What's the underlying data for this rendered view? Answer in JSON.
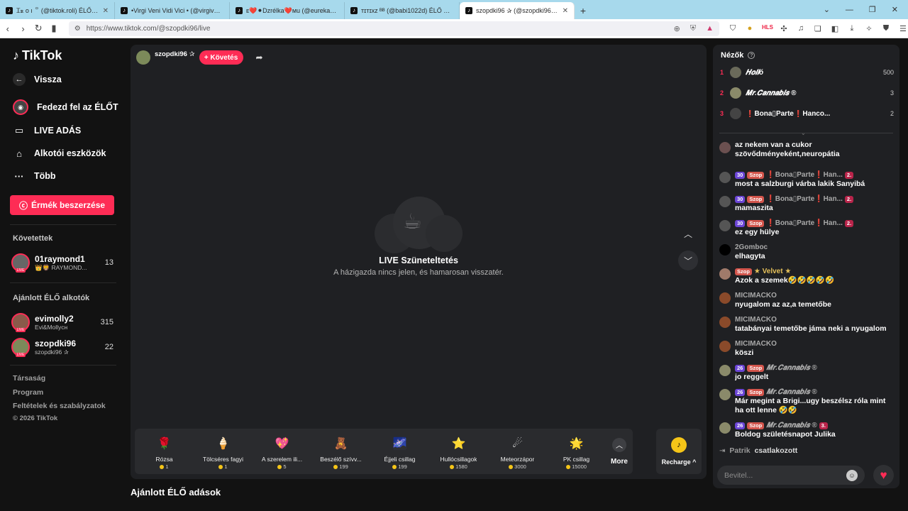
{
  "browser": {
    "tabs": [
      {
        "title": "Ꮖꭱ ᴏ ı ꒪ (@tiktok.roli) ÉLŐ adá",
        "active": false
      },
      {
        "title": "•Virgi Veni Vidi Vici • (@virgivenividi",
        "active": false
      },
      {
        "title": "ᴇ❤️⚫Dᴢrélka❤️ᴍu (@eurekaeurek",
        "active": false
      },
      {
        "title": "ᴛɪᴛɪxᴢ ᴮᴮ (@babi1022d) ÉLŐ adásban",
        "active": false
      },
      {
        "title": "szopdki96 ✰ (@szopdki96) ÉLŐ a",
        "active": true
      }
    ],
    "new_tab": "+",
    "url": "https://www.tiktok.com/@szopdki96/live"
  },
  "sidebar": {
    "logo": "TikTok",
    "back": "Vissza",
    "menu": [
      {
        "label": "Fedezd fel az ÉLŐT",
        "icon": "live-explore-icon"
      },
      {
        "label": "LIVE ADÁS",
        "icon": "video-camera-icon"
      },
      {
        "label": "Alkotói eszközök",
        "icon": "creator-tools-icon"
      },
      {
        "label": "Több",
        "icon": "more-dots-icon"
      }
    ],
    "coins_button": "Érmék beszerzése",
    "following_title": "Követettek",
    "following": [
      {
        "name": "01raymond1",
        "sub": "👑🦁 RAYMOND...",
        "count": "13"
      }
    ],
    "recommended_title": "Ajánlott ÉLŐ alkotók",
    "recommended": [
      {
        "name": "evimolly2",
        "sub": "Evi&Mollycн",
        "count": "315"
      },
      {
        "name": "szopdki96",
        "sub": "szopdki96 ✰",
        "count": "22"
      }
    ],
    "footer": [
      "Társaság",
      "Program",
      "Feltételek és szabályzatok",
      "© 2026 TikTok"
    ]
  },
  "stage": {
    "host_name": "szopdki96 ✰",
    "follow_label": "+ Követés",
    "pause_title": "LIVE Szüneteltetés",
    "pause_sub": "A házigazda nincs jelen, és hamarosan visszatér."
  },
  "gifts": [
    {
      "name": "Rózsa",
      "price": "1",
      "icon": "🌹"
    },
    {
      "name": "Tölcséres fagyi",
      "price": "1",
      "icon": "🍦"
    },
    {
      "name": "A szerelem ili...",
      "price": "5",
      "icon": "💖"
    },
    {
      "name": "Beszélő szívv...",
      "price": "199",
      "icon": "🧸"
    },
    {
      "name": "Éjjeli csillag",
      "price": "199",
      "icon": "🌌"
    },
    {
      "name": "Hullócsillagok",
      "price": "1580",
      "icon": "⭐"
    },
    {
      "name": "Meteorzápor",
      "price": "3000",
      "icon": "☄"
    },
    {
      "name": "PK csillag",
      "price": "15000",
      "icon": "🌟"
    }
  ],
  "more_label": "More",
  "recharge_label": "Recharge ^",
  "recommended_heading": "Ajánlott ÉLŐ adások",
  "panel": {
    "title": "Nézők",
    "viewers": [
      {
        "rank": "1",
        "name": "𝑯𝒐𝒍𝒍ó",
        "count": "500"
      },
      {
        "rank": "2",
        "name": "𝑴𝒓.𝑪𝒂𝒏𝒏𝒂𝒃𝒊𝒔 ®",
        "count": "3"
      },
      {
        "rank": "3",
        "name": "❗Bona▯Parte❗Hanco...",
        "count": "2"
      }
    ],
    "messages": [
      {
        "lvl": "",
        "sub": "",
        "user": "",
        "rank": "",
        "text": "az nekem van a cukor szövődményeként,neuropátia"
      },
      {
        "lvl": "30",
        "sub": "Szop",
        "user": "❗Bona▯Parte❗Han...",
        "rank": "2.",
        "text": "most a salzburgi várba lakik Sanyibá"
      },
      {
        "lvl": "30",
        "sub": "Szop",
        "user": "❗Bona▯Parte❗Han...",
        "rank": "2.",
        "text": "mamaszita"
      },
      {
        "lvl": "30",
        "sub": "Szop",
        "user": "❗Bona▯Parte❗Han...",
        "rank": "2.",
        "text": "ez egy hülye"
      },
      {
        "lvl": "",
        "sub": "",
        "user": "2Gomboc",
        "rank": "",
        "text": "elhagyta"
      },
      {
        "lvl": "",
        "sub": "Szop",
        "user": "★ Velvet ★",
        "rank": "",
        "text": "Azok a szemek🤣🤣🤣🤣🤣"
      },
      {
        "lvl": "",
        "sub": "",
        "user": "MICIMACKO",
        "rank": "",
        "text": "nyugalom az az,a temetőbe"
      },
      {
        "lvl": "",
        "sub": "",
        "user": "MICIMACKO",
        "rank": "",
        "text": "tatabányai temetőbe jáma neki a nyugalom"
      },
      {
        "lvl": "",
        "sub": "",
        "user": "MICIMACKO",
        "rank": "",
        "text": "köszi"
      },
      {
        "lvl": "26",
        "sub": "Szop",
        "user": "𝑴𝒓.𝑪𝒂𝒏𝒏𝒂𝒃𝒊𝒔 ®",
        "rank": "",
        "text": "jo reggelt"
      },
      {
        "lvl": "26",
        "sub": "Szop",
        "user": "𝑴𝒓.𝑪𝒂𝒏𝒏𝒂𝒃𝒊𝒔 ®",
        "rank": "",
        "text": "Már megint a Brigi...ugy beszélsz róla mint ha ott lenne 🤣🤣"
      },
      {
        "lvl": "26",
        "sub": "Szop",
        "user": "𝑴𝒓.𝑪𝒂𝒏𝒏𝒂𝒃𝒊𝒔 ®",
        "rank": "3.",
        "text": "Boldog születésnapot Julika"
      }
    ],
    "join_user": "Patrik",
    "join_text": "csatlakozott",
    "input_placeholder": "Bevitel..."
  }
}
